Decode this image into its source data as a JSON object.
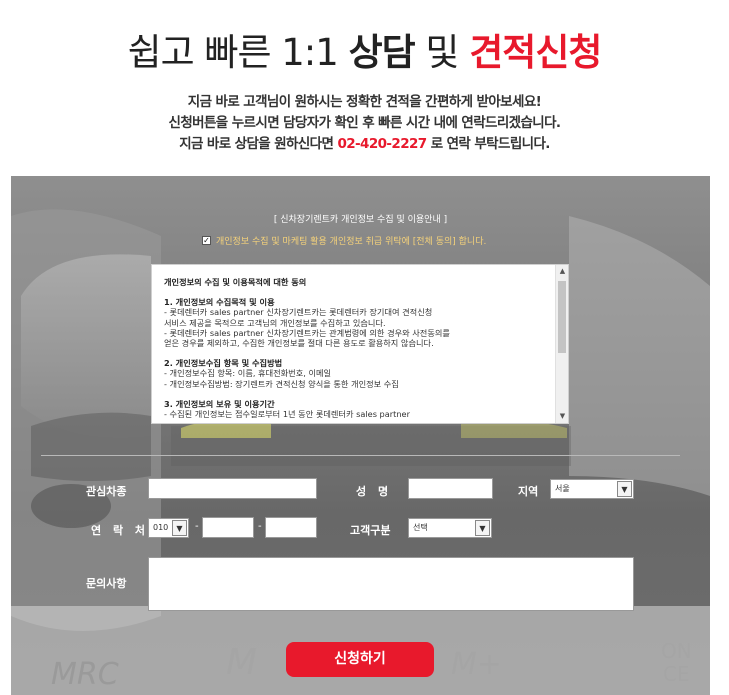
{
  "hero": {
    "title_part1": "쉽고 빠른 1:1 ",
    "title_part2": "상담",
    "title_part3": " 및 ",
    "title_part4": "견적신청",
    "line1": "지금 바로 고객님이 원하시는 정확한 견적을 간편하게 받아보세요!",
    "line2": "신청버튼을 누르시면 담당자가 확인 후 빠른 시간 내에 연락드리겠습니다.",
    "line3_pre": "지금 바로 상담을 원하신다면 ",
    "line3_phone": "02-420-2227",
    "line3_post": " 로 연락 부탁드립니다."
  },
  "consent": {
    "title": "[ 신차장기렌트카 개인정보 수집 및 이용안내 ]",
    "check_label": "개인정보 수집 및 마케팅 활용 개인정보 취급 위탁에 [전체 동의] 합니다.",
    "checked": true,
    "terms": {
      "heading": "개인정보의 수집 및 이용목적에 대한 동의",
      "s1_title": "1. 개인정보의 수집목적 및 이용",
      "s1_l1": "- 롯데렌터카 sales partner 신차장기렌트카는 롯데렌터카 장기대여 견적신청",
      "s1_l2": "서비스 제공을 목적으로 고객님의 개인정보를 수집하고 있습니다.",
      "s1_l3": "- 롯데렌터카 sales partner 신차장기렌트카는 관계법령에 의한 경우와 사전동의를",
      "s1_l4": "얻은 경우를 제외하고, 수집한 개인정보를 절대 다른 용도로 활용하지 않습니다.",
      "s2_title": "2. 개인정보수집 항목 및 수집방법",
      "s2_l1": "- 개인정보수집 항목: 이름, 휴대전화번호, 이메일",
      "s2_l2": "- 개인정보수집방법: 장기렌트카 견적신청 양식을 통한 개인정보 수집",
      "s3_title": "3. 개인정보의 보유 및 이용기간",
      "s3_l1": "- 수집된 개인정보는 접수일로부터 1년 동안 롯데렌터카 sales partner"
    }
  },
  "form": {
    "car_label": "관심차종",
    "car_value": "",
    "name_label": "성  명",
    "name_value": "",
    "region_label": "지역",
    "region_value": "서울",
    "phone_label": "연 락 처",
    "phone_prefix": "010",
    "phone_mid": "",
    "phone_last": "",
    "phone_sep": "-",
    "customer_label": "고객구분",
    "customer_value": "선택",
    "inquiry_label": "문의사항",
    "inquiry_value": ""
  },
  "submit_label": "신청하기",
  "background_badges": [
    "MRC",
    "M",
    "M+",
    "ON",
    "CE"
  ],
  "colors": {
    "accent": "#e8192c",
    "panel": "#7b7b7b",
    "consent_text": "#f5d27a"
  }
}
